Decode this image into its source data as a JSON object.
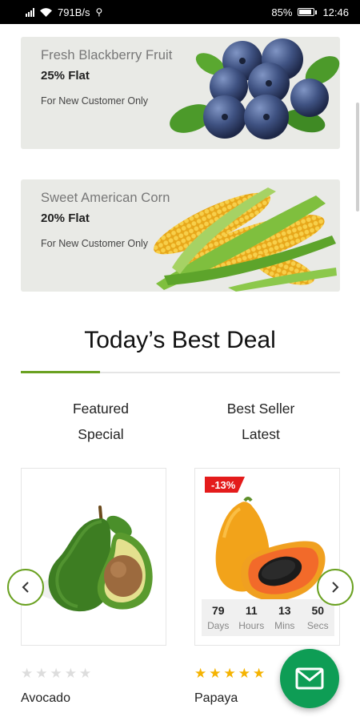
{
  "status_bar": {
    "speed": "791B/s",
    "battery": "85%",
    "time": "12:46",
    "battery_level": 0.85
  },
  "banners": [
    {
      "title": "Fresh Blackberry Fruit",
      "discount": "25% Flat",
      "note": "For New Customer Only"
    },
    {
      "title": "Sweet American Corn",
      "discount": "20% Flat",
      "note": "For New Customer Only"
    }
  ],
  "deals": {
    "heading": "Today’s Best Deal",
    "tabs": [
      {
        "line1": "Featured",
        "line2": "Special"
      },
      {
        "line1": "Best Seller",
        "line2": "Latest"
      }
    ],
    "accent_color": "#6aa121"
  },
  "products": [
    {
      "name": "Avocado",
      "rating": 0,
      "max_rating": 5
    },
    {
      "name": "Papaya",
      "badge": "-13%",
      "rating": 5,
      "max_rating": 5,
      "countdown": [
        {
          "value": "79",
          "label": "Days"
        },
        {
          "value": "11",
          "label": "Hours"
        },
        {
          "value": "13",
          "label": "Mins"
        },
        {
          "value": "50",
          "label": "Secs"
        }
      ]
    }
  ],
  "icons": {
    "prev": "chevron-left-icon",
    "next": "chevron-right-icon",
    "fab": "mail-icon"
  },
  "colors": {
    "fab": "#0e9d55",
    "star_filled": "#f5b301",
    "star_empty": "#dddddd",
    "badge": "#e41b1b"
  }
}
